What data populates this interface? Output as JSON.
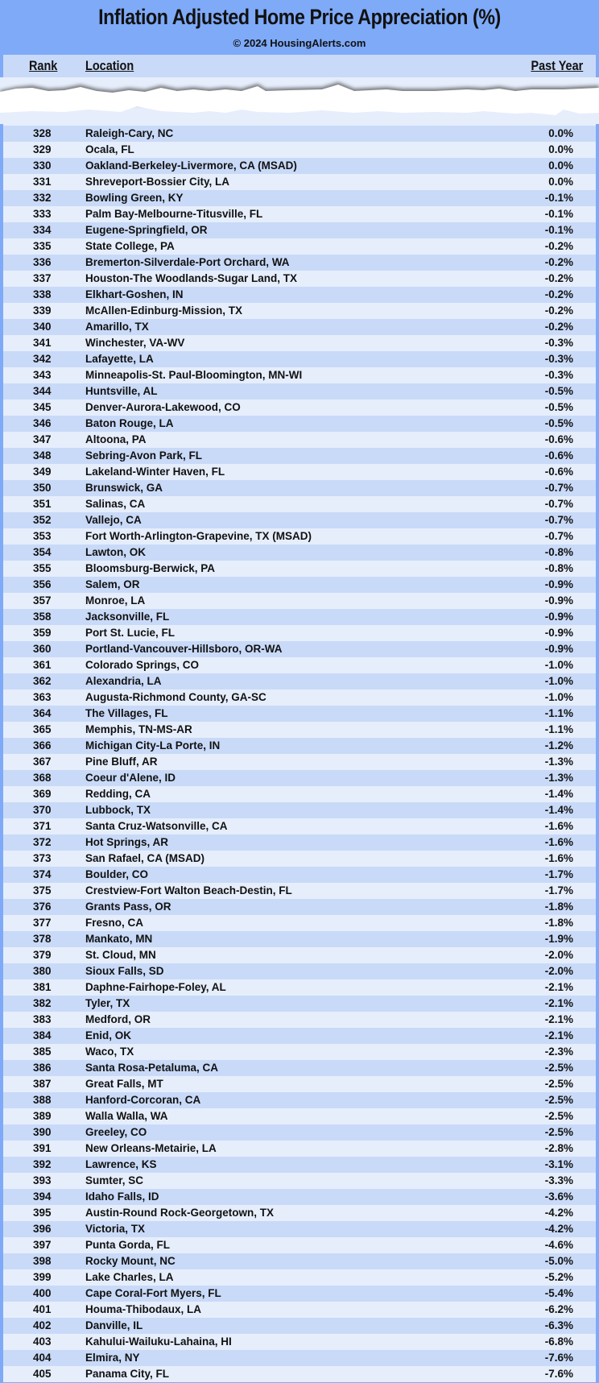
{
  "header": {
    "title": "Inflation Adjusted Home Price Appreciation (%)",
    "subtitle": "© 2024 HousingAlerts.com"
  },
  "columns": {
    "rank": "Rank",
    "location": "Location",
    "past_year": "Past Year"
  },
  "colors": {
    "background": "#7eaaf8",
    "row_dark": "#c9daf8",
    "row_light": "#e6eefc"
  },
  "rows": [
    {
      "rank": "328",
      "location": "Raleigh-Cary, NC",
      "value": "0.0%"
    },
    {
      "rank": "329",
      "location": "Ocala, FL",
      "value": "0.0%"
    },
    {
      "rank": "330",
      "location": "Oakland-Berkeley-Livermore, CA (MSAD)",
      "value": "0.0%"
    },
    {
      "rank": "331",
      "location": "Shreveport-Bossier City, LA",
      "value": "0.0%"
    },
    {
      "rank": "332",
      "location": "Bowling Green, KY",
      "value": "-0.1%"
    },
    {
      "rank": "333",
      "location": "Palm Bay-Melbourne-Titusville, FL",
      "value": "-0.1%"
    },
    {
      "rank": "334",
      "location": "Eugene-Springfield, OR",
      "value": "-0.1%"
    },
    {
      "rank": "335",
      "location": "State College, PA",
      "value": "-0.2%"
    },
    {
      "rank": "336",
      "location": "Bremerton-Silverdale-Port Orchard, WA",
      "value": "-0.2%"
    },
    {
      "rank": "337",
      "location": "Houston-The Woodlands-Sugar Land, TX",
      "value": "-0.2%"
    },
    {
      "rank": "338",
      "location": "Elkhart-Goshen, IN",
      "value": "-0.2%"
    },
    {
      "rank": "339",
      "location": "McAllen-Edinburg-Mission, TX",
      "value": "-0.2%"
    },
    {
      "rank": "340",
      "location": "Amarillo, TX",
      "value": "-0.2%"
    },
    {
      "rank": "341",
      "location": "Winchester, VA-WV",
      "value": "-0.3%"
    },
    {
      "rank": "342",
      "location": "Lafayette, LA",
      "value": "-0.3%"
    },
    {
      "rank": "343",
      "location": "Minneapolis-St. Paul-Bloomington, MN-WI",
      "value": "-0.3%"
    },
    {
      "rank": "344",
      "location": "Huntsville, AL",
      "value": "-0.5%"
    },
    {
      "rank": "345",
      "location": "Denver-Aurora-Lakewood, CO",
      "value": "-0.5%"
    },
    {
      "rank": "346",
      "location": "Baton Rouge, LA",
      "value": "-0.5%"
    },
    {
      "rank": "347",
      "location": "Altoona, PA",
      "value": "-0.6%"
    },
    {
      "rank": "348",
      "location": "Sebring-Avon Park, FL",
      "value": "-0.6%"
    },
    {
      "rank": "349",
      "location": "Lakeland-Winter Haven, FL",
      "value": "-0.6%"
    },
    {
      "rank": "350",
      "location": "Brunswick, GA",
      "value": "-0.7%"
    },
    {
      "rank": "351",
      "location": "Salinas, CA",
      "value": "-0.7%"
    },
    {
      "rank": "352",
      "location": "Vallejo, CA",
      "value": "-0.7%"
    },
    {
      "rank": "353",
      "location": "Fort Worth-Arlington-Grapevine, TX (MSAD)",
      "value": "-0.7%"
    },
    {
      "rank": "354",
      "location": "Lawton, OK",
      "value": "-0.8%"
    },
    {
      "rank": "355",
      "location": "Bloomsburg-Berwick, PA",
      "value": "-0.8%"
    },
    {
      "rank": "356",
      "location": "Salem, OR",
      "value": "-0.9%"
    },
    {
      "rank": "357",
      "location": "Monroe, LA",
      "value": "-0.9%"
    },
    {
      "rank": "358",
      "location": "Jacksonville, FL",
      "value": "-0.9%"
    },
    {
      "rank": "359",
      "location": "Port St. Lucie, FL",
      "value": "-0.9%"
    },
    {
      "rank": "360",
      "location": "Portland-Vancouver-Hillsboro, OR-WA",
      "value": "-0.9%"
    },
    {
      "rank": "361",
      "location": "Colorado Springs, CO",
      "value": "-1.0%"
    },
    {
      "rank": "362",
      "location": "Alexandria, LA",
      "value": "-1.0%"
    },
    {
      "rank": "363",
      "location": "Augusta-Richmond County, GA-SC",
      "value": "-1.0%"
    },
    {
      "rank": "364",
      "location": "The Villages, FL",
      "value": "-1.1%"
    },
    {
      "rank": "365",
      "location": "Memphis, TN-MS-AR",
      "value": "-1.1%"
    },
    {
      "rank": "366",
      "location": "Michigan City-La Porte, IN",
      "value": "-1.2%"
    },
    {
      "rank": "367",
      "location": "Pine Bluff, AR",
      "value": "-1.3%"
    },
    {
      "rank": "368",
      "location": "Coeur d'Alene, ID",
      "value": "-1.3%"
    },
    {
      "rank": "369",
      "location": "Redding, CA",
      "value": "-1.4%"
    },
    {
      "rank": "370",
      "location": "Lubbock, TX",
      "value": "-1.4%"
    },
    {
      "rank": "371",
      "location": "Santa Cruz-Watsonville, CA",
      "value": "-1.6%"
    },
    {
      "rank": "372",
      "location": "Hot Springs, AR",
      "value": "-1.6%"
    },
    {
      "rank": "373",
      "location": "San Rafael, CA (MSAD)",
      "value": "-1.6%"
    },
    {
      "rank": "374",
      "location": "Boulder, CO",
      "value": "-1.7%"
    },
    {
      "rank": "375",
      "location": "Crestview-Fort Walton Beach-Destin, FL",
      "value": "-1.7%"
    },
    {
      "rank": "376",
      "location": "Grants Pass, OR",
      "value": "-1.8%"
    },
    {
      "rank": "377",
      "location": "Fresno, CA",
      "value": "-1.8%"
    },
    {
      "rank": "378",
      "location": "Mankato, MN",
      "value": "-1.9%"
    },
    {
      "rank": "379",
      "location": "St. Cloud, MN",
      "value": "-2.0%"
    },
    {
      "rank": "380",
      "location": "Sioux Falls, SD",
      "value": "-2.0%"
    },
    {
      "rank": "381",
      "location": "Daphne-Fairhope-Foley, AL",
      "value": "-2.1%"
    },
    {
      "rank": "382",
      "location": "Tyler, TX",
      "value": "-2.1%"
    },
    {
      "rank": "383",
      "location": "Medford, OR",
      "value": "-2.1%"
    },
    {
      "rank": "384",
      "location": "Enid, OK",
      "value": "-2.1%"
    },
    {
      "rank": "385",
      "location": "Waco, TX",
      "value": "-2.3%"
    },
    {
      "rank": "386",
      "location": "Santa Rosa-Petaluma, CA",
      "value": "-2.5%"
    },
    {
      "rank": "387",
      "location": "Great Falls, MT",
      "value": "-2.5%"
    },
    {
      "rank": "388",
      "location": "Hanford-Corcoran, CA",
      "value": "-2.5%"
    },
    {
      "rank": "389",
      "location": "Walla Walla, WA",
      "value": "-2.5%"
    },
    {
      "rank": "390",
      "location": "Greeley, CO",
      "value": "-2.5%"
    },
    {
      "rank": "391",
      "location": "New Orleans-Metairie, LA",
      "value": "-2.8%"
    },
    {
      "rank": "392",
      "location": "Lawrence, KS",
      "value": "-3.1%"
    },
    {
      "rank": "393",
      "location": "Sumter, SC",
      "value": "-3.3%"
    },
    {
      "rank": "394",
      "location": "Idaho Falls, ID",
      "value": "-3.6%"
    },
    {
      "rank": "395",
      "location": "Austin-Round Rock-Georgetown, TX",
      "value": "-4.2%"
    },
    {
      "rank": "396",
      "location": "Victoria, TX",
      "value": "-4.2%"
    },
    {
      "rank": "397",
      "location": "Punta Gorda, FL",
      "value": "-4.6%"
    },
    {
      "rank": "398",
      "location": "Rocky Mount, NC",
      "value": "-5.0%"
    },
    {
      "rank": "399",
      "location": "Lake Charles, LA",
      "value": "-5.2%"
    },
    {
      "rank": "400",
      "location": "Cape Coral-Fort Myers, FL",
      "value": "-5.4%"
    },
    {
      "rank": "401",
      "location": "Houma-Thibodaux, LA",
      "value": "-6.2%"
    },
    {
      "rank": "402",
      "location": "Danville, IL",
      "value": "-6.3%"
    },
    {
      "rank": "403",
      "location": "Kahului-Wailuku-Lahaina, HI",
      "value": "-6.8%"
    },
    {
      "rank": "404",
      "location": "Elmira, NY",
      "value": "-7.6%"
    },
    {
      "rank": "405",
      "location": "Panama City, FL",
      "value": "-7.6%"
    }
  ]
}
